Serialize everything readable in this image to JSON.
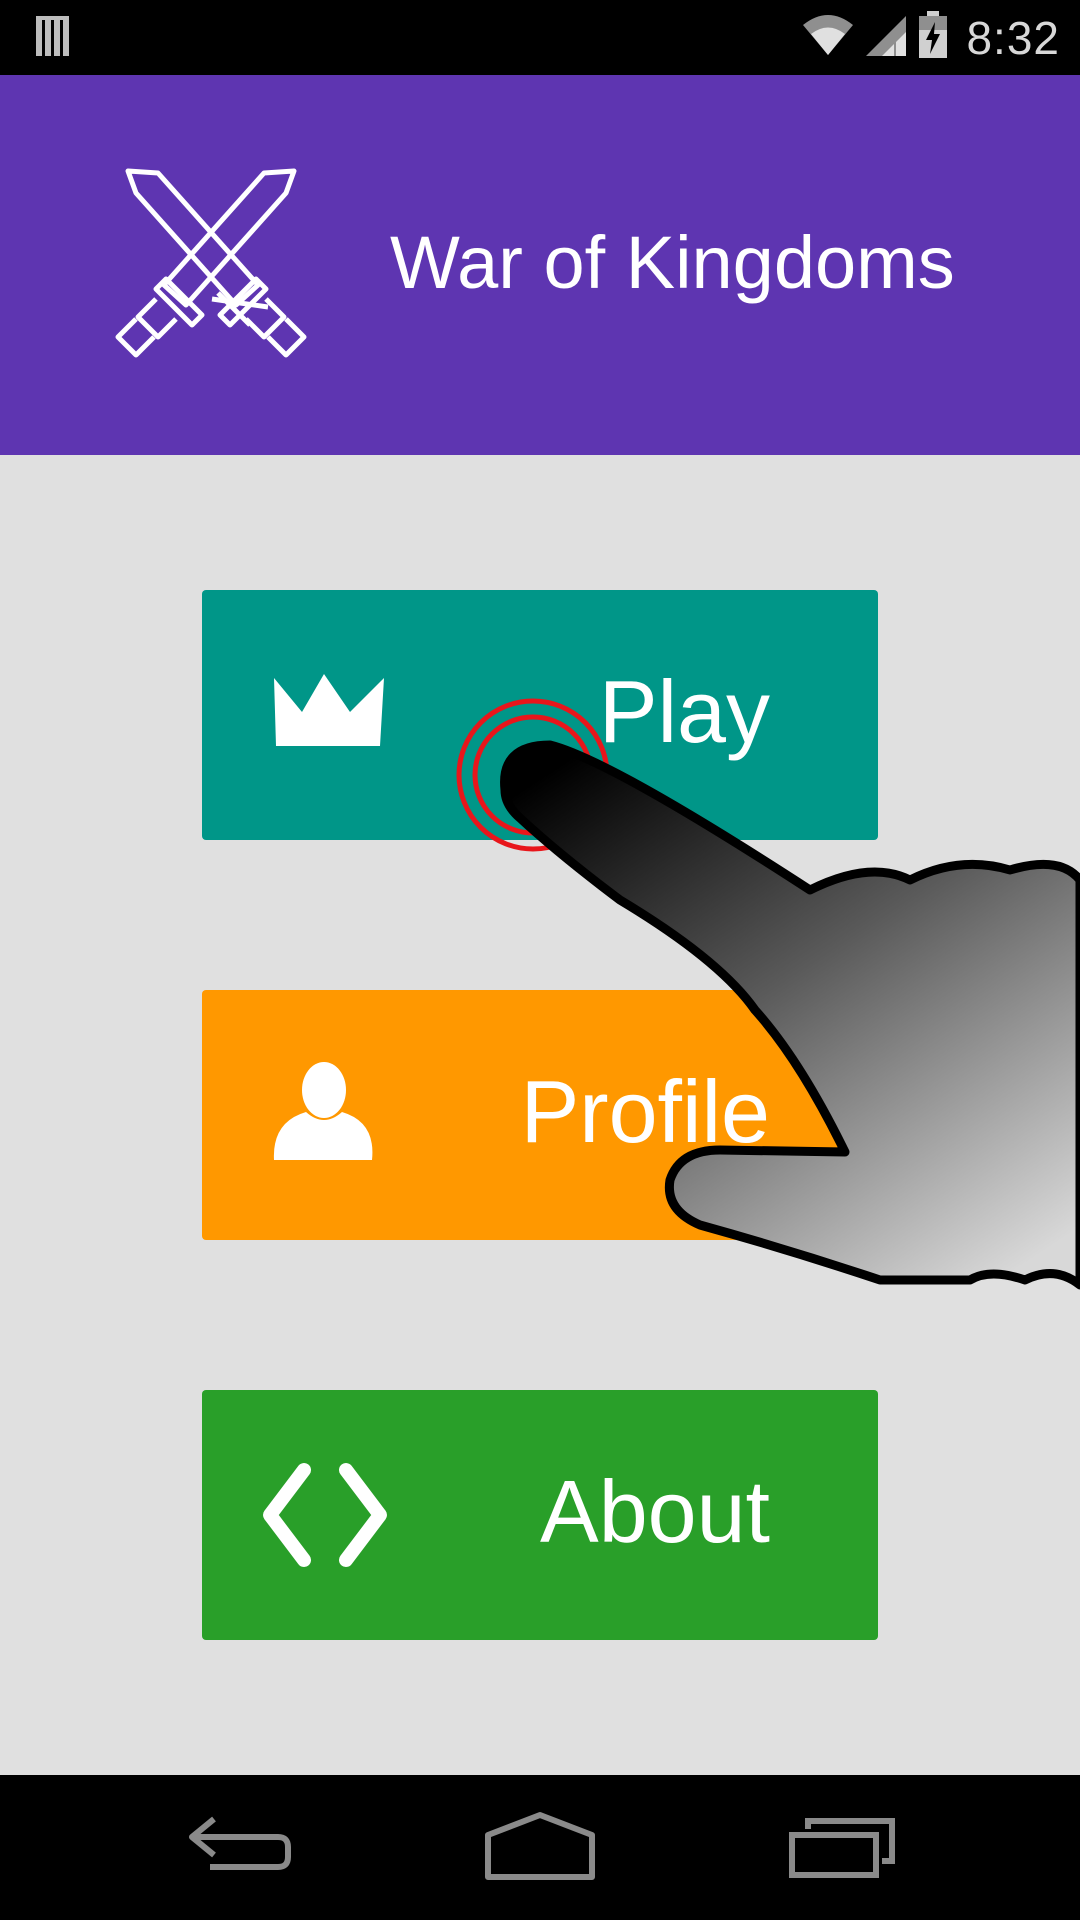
{
  "status_bar": {
    "time": "8:32",
    "icons": [
      "sim-card-icon",
      "wifi-icon",
      "cell-signal-icon",
      "battery-charging-icon"
    ]
  },
  "app_bar": {
    "title": "War of Kingdoms",
    "logo_icon": "crossed-swords-icon",
    "color": "#5e35b1"
  },
  "menu": {
    "buttons": [
      {
        "label": "Play",
        "icon": "crown-icon",
        "color": "#009688"
      },
      {
        "label": "Profile",
        "icon": "person-icon",
        "color": "#ff9800"
      },
      {
        "label": "About",
        "icon": "code-brackets-icon",
        "color": "#299f29"
      }
    ]
  },
  "gesture": {
    "type": "tap",
    "icon": "pointing-hand-icon",
    "indicator_color": "#e8161b"
  },
  "nav_bar": {
    "icons": [
      "back-icon",
      "home-icon",
      "recents-icon"
    ]
  }
}
